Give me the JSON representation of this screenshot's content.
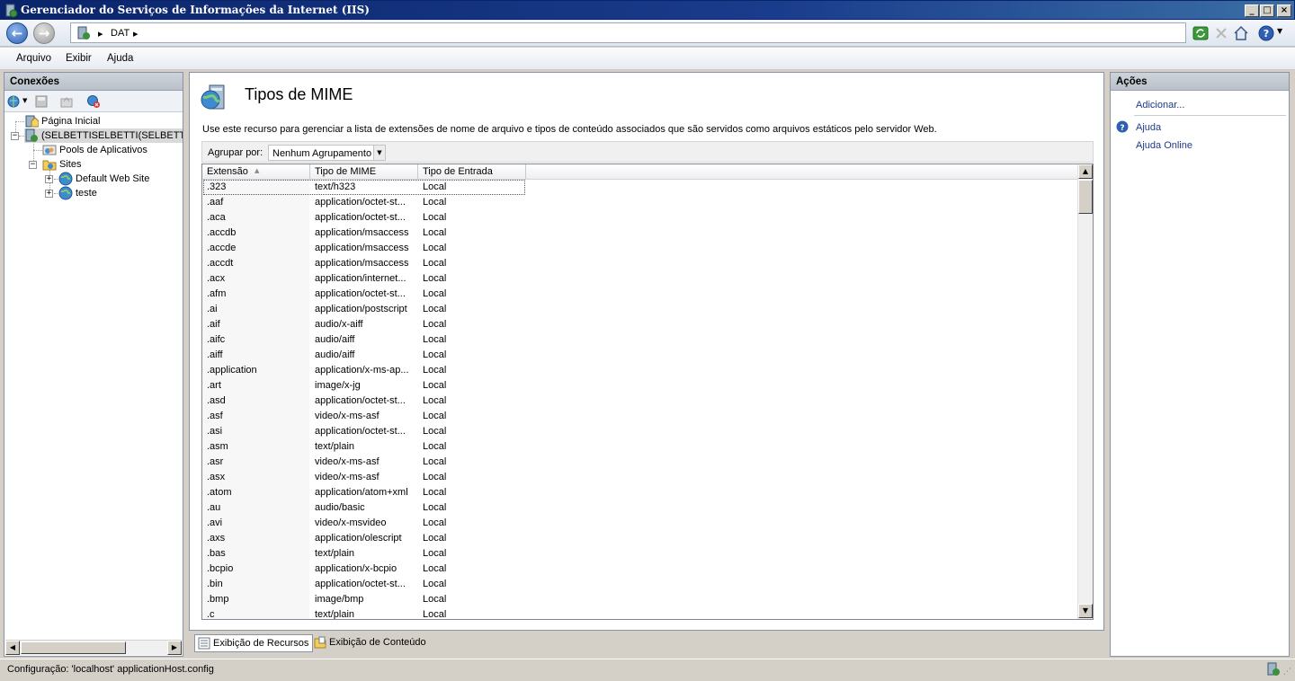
{
  "window": {
    "title": "Gerenciador do Serviços de Informações da Internet (IIS)",
    "controls": {
      "minimize": "_",
      "maximize": "□",
      "close": "×"
    }
  },
  "navigation": {
    "back_icon": "back-arrow-icon",
    "forward_icon": "forward-arrow-icon",
    "address_segments": [
      "▸",
      "DAT",
      "▸"
    ],
    "toolbar_icons": [
      "refresh-icon",
      "stop-icon",
      "home-icon",
      "help-icon"
    ]
  },
  "menu": {
    "items": [
      "Arquivo",
      "Exibir",
      "Ajuda"
    ]
  },
  "connections": {
    "title": "Conexões",
    "tools": [
      "connect-icon",
      "save-icon",
      "up-icon",
      "disconnect-icon"
    ],
    "tree": [
      {
        "label": "Página Inicial",
        "icon": "home-page-icon"
      },
      {
        "label": "(SELBETTISELBETTI(SELBETTI\\re",
        "icon": "server-icon"
      },
      {
        "label": "Pools de Aplicativos",
        "icon": "app-pools-icon"
      },
      {
        "label": "Sites",
        "icon": "sites-folder-icon"
      },
      {
        "label": "Default Web Site",
        "icon": "globe-icon"
      },
      {
        "label": "teste",
        "icon": "globe-icon"
      }
    ]
  },
  "feature": {
    "title": "Tipos de MIME",
    "description": "Use este recurso para gerenciar a lista de extensões de nome de arquivo e tipos de conteúdo associados que são servidos como arquivos estáticos pelo servidor Web.",
    "group_label": "Agrupar por:",
    "group_value": "Nenhum Agrupamento",
    "columns": [
      "Extensão",
      "Tipo de MIME",
      "Tipo de Entrada"
    ],
    "sort_indicator": "▲",
    "rows": [
      [
        ".323",
        "text/h323",
        "Local"
      ],
      [
        ".aaf",
        "application/octet-st...",
        "Local"
      ],
      [
        ".aca",
        "application/octet-st...",
        "Local"
      ],
      [
        ".accdb",
        "application/msaccess",
        "Local"
      ],
      [
        ".accde",
        "application/msaccess",
        "Local"
      ],
      [
        ".accdt",
        "application/msaccess",
        "Local"
      ],
      [
        ".acx",
        "application/internet...",
        "Local"
      ],
      [
        ".afm",
        "application/octet-st...",
        "Local"
      ],
      [
        ".ai",
        "application/postscript",
        "Local"
      ],
      [
        ".aif",
        "audio/x-aiff",
        "Local"
      ],
      [
        ".aifc",
        "audio/aiff",
        "Local"
      ],
      [
        ".aiff",
        "audio/aiff",
        "Local"
      ],
      [
        ".application",
        "application/x-ms-ap...",
        "Local"
      ],
      [
        ".art",
        "image/x-jg",
        "Local"
      ],
      [
        ".asd",
        "application/octet-st...",
        "Local"
      ],
      [
        ".asf",
        "video/x-ms-asf",
        "Local"
      ],
      [
        ".asi",
        "application/octet-st...",
        "Local"
      ],
      [
        ".asm",
        "text/plain",
        "Local"
      ],
      [
        ".asr",
        "video/x-ms-asf",
        "Local"
      ],
      [
        ".asx",
        "video/x-ms-asf",
        "Local"
      ],
      [
        ".atom",
        "application/atom+xml",
        "Local"
      ],
      [
        ".au",
        "audio/basic",
        "Local"
      ],
      [
        ".avi",
        "video/x-msvideo",
        "Local"
      ],
      [
        ".axs",
        "application/olescript",
        "Local"
      ],
      [
        ".bas",
        "text/plain",
        "Local"
      ],
      [
        ".bcpio",
        "application/x-bcpio",
        "Local"
      ],
      [
        ".bin",
        "application/octet-st...",
        "Local"
      ],
      [
        ".bmp",
        "image/bmp",
        "Local"
      ],
      [
        ".c",
        "text/plain",
        "Local"
      ]
    ]
  },
  "view_tabs": {
    "features": "Exibição de Recursos",
    "content": "Exibição de Conteúdo"
  },
  "actions": {
    "title": "Ações",
    "add": "Adicionar...",
    "help": "Ajuda",
    "online_help": "Ajuda Online"
  },
  "status": {
    "text": "Configuração: 'localhost' applicationHost.config"
  },
  "colors": {
    "title_bar": "#0a246a",
    "link": "#1e3a8a",
    "pane_header": "#b9c0c9"
  }
}
